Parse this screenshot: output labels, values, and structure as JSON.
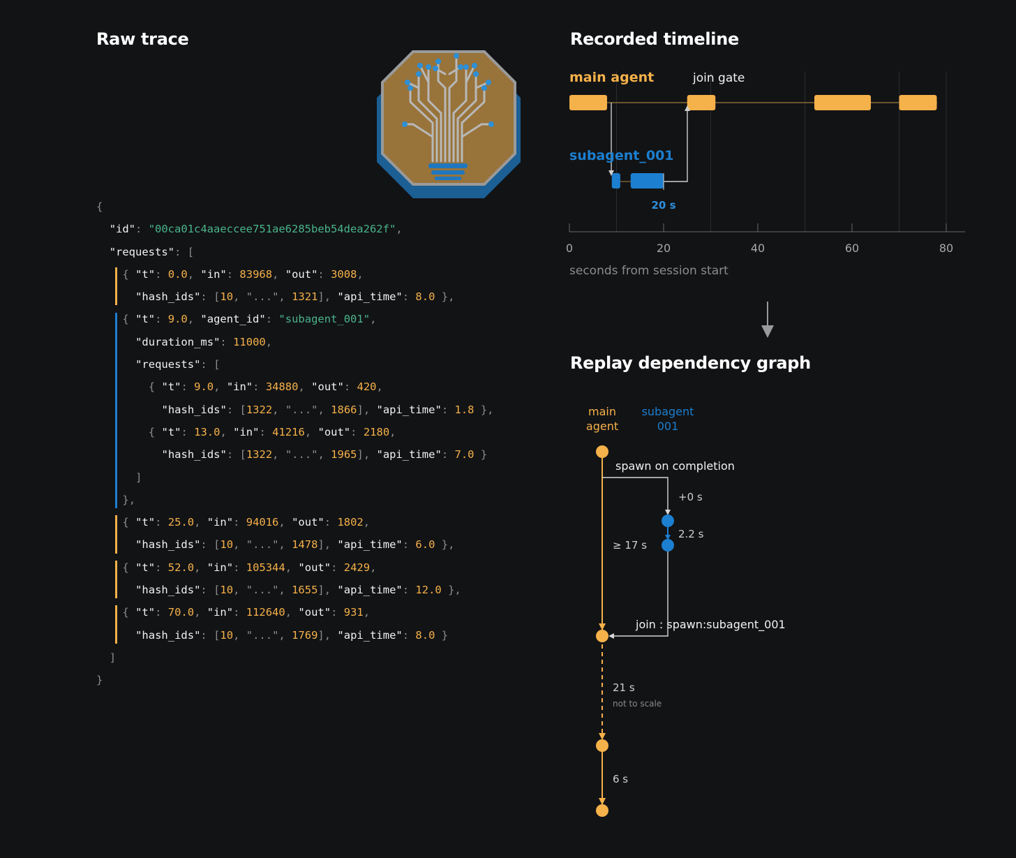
{
  "raw_trace": {
    "title": "Raw trace",
    "code_lines": [
      {
        "indent": 0,
        "tokens": [
          {
            "c": "p",
            "t": "{"
          }
        ]
      },
      {
        "indent": 1,
        "tokens": [
          {
            "c": "k",
            "t": "\"id\""
          },
          {
            "c": "p",
            "t": ": "
          },
          {
            "c": "s",
            "t": "\"00ca01c4aaeccee751ae6285beb54dea262f\""
          },
          {
            "c": "p",
            "t": ","
          }
        ]
      },
      {
        "indent": 1,
        "tokens": [
          {
            "c": "k",
            "t": "\"requests\""
          },
          {
            "c": "p",
            "t": ": ["
          }
        ]
      },
      {
        "indent": 2,
        "bar": "o",
        "tokens": [
          {
            "c": "p",
            "t": "{ "
          },
          {
            "c": "k",
            "t": "\"t\""
          },
          {
            "c": "p",
            "t": ": "
          },
          {
            "c": "n",
            "t": "0.0"
          },
          {
            "c": "p",
            "t": ", "
          },
          {
            "c": "k",
            "t": "\"in\""
          },
          {
            "c": "p",
            "t": ": "
          },
          {
            "c": "n",
            "t": "83968"
          },
          {
            "c": "p",
            "t": ", "
          },
          {
            "c": "k",
            "t": "\"out\""
          },
          {
            "c": "p",
            "t": ": "
          },
          {
            "c": "n",
            "t": "3008"
          },
          {
            "c": "p",
            "t": ","
          }
        ]
      },
      {
        "indent": 3,
        "bar": "o",
        "tokens": [
          {
            "c": "k",
            "t": "\"hash_ids\""
          },
          {
            "c": "p",
            "t": ": ["
          },
          {
            "c": "n",
            "t": "10"
          },
          {
            "c": "p",
            "t": ", \"...\", "
          },
          {
            "c": "n",
            "t": "1321"
          },
          {
            "c": "p",
            "t": "], "
          },
          {
            "c": "k",
            "t": "\"api_time\""
          },
          {
            "c": "p",
            "t": ": "
          },
          {
            "c": "n",
            "t": "8.0"
          },
          {
            "c": "p",
            "t": " },"
          }
        ]
      },
      {
        "indent": 2,
        "bar": "b",
        "tokens": [
          {
            "c": "p",
            "t": "{ "
          },
          {
            "c": "k",
            "t": "\"t\""
          },
          {
            "c": "p",
            "t": ": "
          },
          {
            "c": "n",
            "t": "9.0"
          },
          {
            "c": "p",
            "t": ", "
          },
          {
            "c": "k",
            "t": "\"agent_id\""
          },
          {
            "c": "p",
            "t": ": "
          },
          {
            "c": "s",
            "t": "\"subagent_001\""
          },
          {
            "c": "p",
            "t": ","
          }
        ]
      },
      {
        "indent": 3,
        "bar": "b",
        "tokens": [
          {
            "c": "k",
            "t": "\"duration_ms\""
          },
          {
            "c": "p",
            "t": ": "
          },
          {
            "c": "n",
            "t": "11000"
          },
          {
            "c": "p",
            "t": ","
          }
        ]
      },
      {
        "indent": 3,
        "bar": "b",
        "tokens": [
          {
            "c": "k",
            "t": "\"requests\""
          },
          {
            "c": "p",
            "t": ": ["
          }
        ]
      },
      {
        "indent": 4,
        "bar": "b",
        "tokens": [
          {
            "c": "p",
            "t": "{ "
          },
          {
            "c": "k",
            "t": "\"t\""
          },
          {
            "c": "p",
            "t": ": "
          },
          {
            "c": "n",
            "t": "9.0"
          },
          {
            "c": "p",
            "t": ", "
          },
          {
            "c": "k",
            "t": "\"in\""
          },
          {
            "c": "p",
            "t": ": "
          },
          {
            "c": "n",
            "t": "34880"
          },
          {
            "c": "p",
            "t": ", "
          },
          {
            "c": "k",
            "t": "\"out\""
          },
          {
            "c": "p",
            "t": ": "
          },
          {
            "c": "n",
            "t": "420"
          },
          {
            "c": "p",
            "t": ","
          }
        ]
      },
      {
        "indent": 5,
        "bar": "b",
        "tokens": [
          {
            "c": "k",
            "t": "\"hash_ids\""
          },
          {
            "c": "p",
            "t": ": ["
          },
          {
            "c": "n",
            "t": "1322"
          },
          {
            "c": "p",
            "t": ", \"...\", "
          },
          {
            "c": "n",
            "t": "1866"
          },
          {
            "c": "p",
            "t": "], "
          },
          {
            "c": "k",
            "t": "\"api_time\""
          },
          {
            "c": "p",
            "t": ": "
          },
          {
            "c": "n",
            "t": "1.8"
          },
          {
            "c": "p",
            "t": " },"
          }
        ]
      },
      {
        "indent": 4,
        "bar": "b",
        "tokens": [
          {
            "c": "p",
            "t": "{ "
          },
          {
            "c": "k",
            "t": "\"t\""
          },
          {
            "c": "p",
            "t": ": "
          },
          {
            "c": "n",
            "t": "13.0"
          },
          {
            "c": "p",
            "t": ", "
          },
          {
            "c": "k",
            "t": "\"in\""
          },
          {
            "c": "p",
            "t": ": "
          },
          {
            "c": "n",
            "t": "41216"
          },
          {
            "c": "p",
            "t": ", "
          },
          {
            "c": "k",
            "t": "\"out\""
          },
          {
            "c": "p",
            "t": ": "
          },
          {
            "c": "n",
            "t": "2180"
          },
          {
            "c": "p",
            "t": ","
          }
        ]
      },
      {
        "indent": 5,
        "bar": "b",
        "tokens": [
          {
            "c": "k",
            "t": "\"hash_ids\""
          },
          {
            "c": "p",
            "t": ": ["
          },
          {
            "c": "n",
            "t": "1322"
          },
          {
            "c": "p",
            "t": ", \"...\", "
          },
          {
            "c": "n",
            "t": "1965"
          },
          {
            "c": "p",
            "t": "], "
          },
          {
            "c": "k",
            "t": "\"api_time\""
          },
          {
            "c": "p",
            "t": ": "
          },
          {
            "c": "n",
            "t": "7.0"
          },
          {
            "c": "p",
            "t": " }"
          }
        ]
      },
      {
        "indent": 3,
        "bar": "b",
        "tokens": [
          {
            "c": "p",
            "t": "]"
          }
        ]
      },
      {
        "indent": 2,
        "bar": "b",
        "tokens": [
          {
            "c": "p",
            "t": "},"
          }
        ]
      },
      {
        "indent": 2,
        "bar": "o",
        "tokens": [
          {
            "c": "p",
            "t": "{ "
          },
          {
            "c": "k",
            "t": "\"t\""
          },
          {
            "c": "p",
            "t": ": "
          },
          {
            "c": "n",
            "t": "25.0"
          },
          {
            "c": "p",
            "t": ", "
          },
          {
            "c": "k",
            "t": "\"in\""
          },
          {
            "c": "p",
            "t": ": "
          },
          {
            "c": "n",
            "t": "94016"
          },
          {
            "c": "p",
            "t": ", "
          },
          {
            "c": "k",
            "t": "\"out\""
          },
          {
            "c": "p",
            "t": ": "
          },
          {
            "c": "n",
            "t": "1802"
          },
          {
            "c": "p",
            "t": ","
          }
        ]
      },
      {
        "indent": 3,
        "bar": "o",
        "tokens": [
          {
            "c": "k",
            "t": "\"hash_ids\""
          },
          {
            "c": "p",
            "t": ": ["
          },
          {
            "c": "n",
            "t": "10"
          },
          {
            "c": "p",
            "t": ", \"...\", "
          },
          {
            "c": "n",
            "t": "1478"
          },
          {
            "c": "p",
            "t": "], "
          },
          {
            "c": "k",
            "t": "\"api_time\""
          },
          {
            "c": "p",
            "t": ": "
          },
          {
            "c": "n",
            "t": "6.0"
          },
          {
            "c": "p",
            "t": " },"
          }
        ]
      },
      {
        "indent": 2,
        "bar": "o",
        "tokens": [
          {
            "c": "p",
            "t": "{ "
          },
          {
            "c": "k",
            "t": "\"t\""
          },
          {
            "c": "p",
            "t": ": "
          },
          {
            "c": "n",
            "t": "52.0"
          },
          {
            "c": "p",
            "t": ", "
          },
          {
            "c": "k",
            "t": "\"in\""
          },
          {
            "c": "p",
            "t": ": "
          },
          {
            "c": "n",
            "t": "105344"
          },
          {
            "c": "p",
            "t": ", "
          },
          {
            "c": "k",
            "t": "\"out\""
          },
          {
            "c": "p",
            "t": ": "
          },
          {
            "c": "n",
            "t": "2429"
          },
          {
            "c": "p",
            "t": ","
          }
        ]
      },
      {
        "indent": 3,
        "bar": "o",
        "tokens": [
          {
            "c": "k",
            "t": "\"hash_ids\""
          },
          {
            "c": "p",
            "t": ": ["
          },
          {
            "c": "n",
            "t": "10"
          },
          {
            "c": "p",
            "t": ", \"...\", "
          },
          {
            "c": "n",
            "t": "1655"
          },
          {
            "c": "p",
            "t": "], "
          },
          {
            "c": "k",
            "t": "\"api_time\""
          },
          {
            "c": "p",
            "t": ": "
          },
          {
            "c": "n",
            "t": "12.0"
          },
          {
            "c": "p",
            "t": " },"
          }
        ]
      },
      {
        "indent": 2,
        "bar": "o",
        "tokens": [
          {
            "c": "p",
            "t": "{ "
          },
          {
            "c": "k",
            "t": "\"t\""
          },
          {
            "c": "p",
            "t": ": "
          },
          {
            "c": "n",
            "t": "70.0"
          },
          {
            "c": "p",
            "t": ", "
          },
          {
            "c": "k",
            "t": "\"in\""
          },
          {
            "c": "p",
            "t": ": "
          },
          {
            "c": "n",
            "t": "112640"
          },
          {
            "c": "p",
            "t": ", "
          },
          {
            "c": "k",
            "t": "\"out\""
          },
          {
            "c": "p",
            "t": ": "
          },
          {
            "c": "n",
            "t": "931"
          },
          {
            "c": "p",
            "t": ","
          }
        ]
      },
      {
        "indent": 3,
        "bar": "o",
        "tokens": [
          {
            "c": "k",
            "t": "\"hash_ids\""
          },
          {
            "c": "p",
            "t": ": ["
          },
          {
            "c": "n",
            "t": "10"
          },
          {
            "c": "p",
            "t": ", \"...\", "
          },
          {
            "c": "n",
            "t": "1769"
          },
          {
            "c": "p",
            "t": "], "
          },
          {
            "c": "k",
            "t": "\"api_time\""
          },
          {
            "c": "p",
            "t": ": "
          },
          {
            "c": "n",
            "t": "8.0"
          },
          {
            "c": "p",
            "t": " }"
          }
        ]
      },
      {
        "indent": 1,
        "tokens": [
          {
            "c": "p",
            "t": "]"
          }
        ]
      },
      {
        "indent": 0,
        "tokens": [
          {
            "c": "p",
            "t": "}"
          }
        ]
      }
    ]
  },
  "badge": {
    "icon": "circuit-tree-lightbulb-icon"
  },
  "timeline": {
    "title": "Recorded timeline",
    "main_label": "main agent",
    "join_label": "join gate",
    "sub_label": "subagent_001",
    "sub_duration_label": "20 s",
    "xlabel": "seconds from session start",
    "ticks": [
      "0",
      "20",
      "40",
      "60",
      "80"
    ]
  },
  "graph": {
    "title": "Replay dependency graph",
    "main_label_1": "main",
    "main_label_2": "agent",
    "sub_label_1": "subagent",
    "sub_label_2": "001",
    "spawn_label": "spawn on completion",
    "offset_label": "+0 s",
    "sub_gap_label": "2.2 s",
    "min_wait_label": "≥ 17 s",
    "join_label": "join : spawn:subagent_001",
    "gap_label": "21 s",
    "scale_note": "not to scale",
    "last_gap_label": "6 s"
  },
  "colors": {
    "main": "#f5b14a",
    "sub": "#1c7fd0",
    "bg": "#121315",
    "axis": "#8a8a8a"
  },
  "chart_data": {
    "type": "bar",
    "title": "Recorded timeline",
    "xlabel": "seconds from session start",
    "xlim": [
      0,
      84
    ],
    "xticks": [
      0,
      20,
      40,
      60,
      80
    ],
    "series": [
      {
        "name": "main agent",
        "spans": [
          [
            0,
            8
          ],
          [
            25,
            31
          ],
          [
            52,
            64
          ],
          [
            70,
            78
          ]
        ]
      },
      {
        "name": "subagent_001",
        "spans": [
          [
            9,
            10.8
          ],
          [
            13,
            20
          ]
        ]
      }
    ]
  }
}
